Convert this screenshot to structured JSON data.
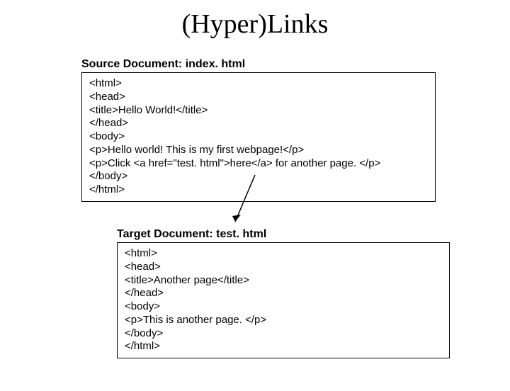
{
  "title": "(Hyper)Links",
  "source": {
    "label": "Source Document: index. html",
    "lines": [
      "<html>",
      "<head>",
      "<title>Hello World!</title>",
      "</head>",
      "<body>",
      "<p>Hello world! This is my first webpage!</p>",
      "<p>Click <a href=\"test. html\">here</a> for another page. </p>",
      "</body>",
      "</html>"
    ]
  },
  "target": {
    "label": "Target Document: test. html",
    "lines": [
      "<html>",
      "<head>",
      "<title>Another page</title>",
      "</head>",
      "<body>",
      "<p>This is another page. </p>",
      "</body>",
      "</html>"
    ]
  }
}
